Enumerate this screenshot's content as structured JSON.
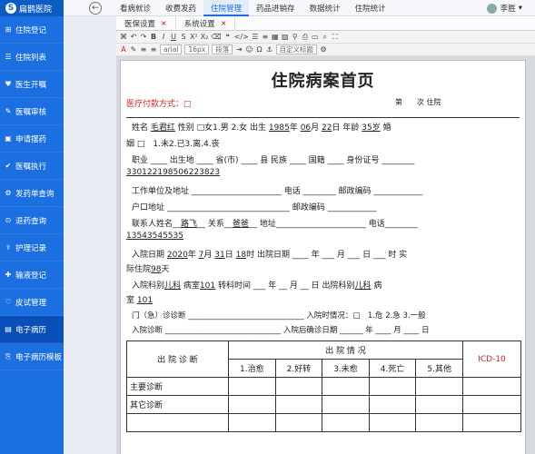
{
  "app": {
    "name": "扁鹊医院"
  },
  "sidebar": {
    "items": [
      {
        "label": "住院登记",
        "icon": "⊞"
      },
      {
        "label": "住院列表",
        "icon": "☰"
      },
      {
        "label": "医生开嘱",
        "icon": "♥"
      },
      {
        "label": "医嘱审核",
        "icon": "✎"
      },
      {
        "label": "申请摆药",
        "icon": "▣"
      },
      {
        "label": "医嘱执行",
        "icon": "✔"
      },
      {
        "label": "发药单查询",
        "icon": "⚙"
      },
      {
        "label": "退药查询",
        "icon": "⊙"
      },
      {
        "label": "护理记录",
        "icon": "⚕"
      },
      {
        "label": "输液登记",
        "icon": "✚"
      },
      {
        "label": "皮试管理",
        "icon": "♡"
      },
      {
        "label": "电子病历",
        "icon": "▤"
      },
      {
        "label": "电子病历模板",
        "icon": "⎘"
      }
    ],
    "active_index": 11
  },
  "top_tabs": [
    "看病就诊",
    "收费发药",
    "住院管理",
    "药品进销存",
    "数据统计",
    "住院统计"
  ],
  "top_active": 2,
  "user": {
    "name": "李胜"
  },
  "sub_tabs": [
    {
      "label": "医保设置"
    },
    {
      "label": "系统设置"
    }
  ],
  "toolbar": {
    "font": "arial",
    "size": "16px",
    "para": "段落",
    "custom": "自定义标题"
  },
  "doc": {
    "title": "住院病案首页",
    "pay_label": "医疗付款方式：□",
    "admit_no": "第　　次 住院",
    "name_label": "姓名",
    "name": "毛君红",
    "sex_label": "性别 □女1.男 2.女 出生",
    "birth_y": "1985",
    "birth_m": "06",
    "birth_d": "22",
    "age_label": "年龄",
    "age": "35岁",
    "marry_label": "婚",
    "marry_line": "姻 □　1.未2.已3.离.4.丧",
    "job_line": "职业 ____ 出生地 ____ 省(市) ____ 县 民族 ____ 国籍 ____ 身份证号 ________",
    "id": "330122198506223823",
    "work_line": "工作单位及地址 ______________________ 电话 ________ 邮政编码 ____________",
    "home_line": "户口地址 ______________________________ 邮政编码 ____________",
    "contact_name": "路飞",
    "contact_rel": "爸爸",
    "contact_label": "联系人姓名",
    "rel_label": "关系",
    "addr_label": "地址",
    "tel_label": "电话",
    "contact_tel": "13543545535",
    "in_y": "2020",
    "in_m": "7",
    "in_d": "31",
    "in_h": "18",
    "in_label": "入院日期",
    "out_line": "出院日期 ____ 年 ___ 月 ___ 日 ___ 时 实",
    "days_label": "际住院",
    "days": "98",
    "days_unit": "天",
    "dept_in": "儿科",
    "room_in": "101",
    "dept_label": "入院科别",
    "room_label": "病室",
    "transfer_line": "转科时间 ___ 年 __ 月 __ 日 出院科别",
    "dept_out": "儿科",
    "room_out_label": "病",
    "room_out": "101",
    "outpatient_line": "门（急）诊诊断 ______________________________ 入院时情况：□　1.危 2.急 3.一般",
    "admit_diag_line": "入院诊断 ______________________________ 入院后确诊日期 ______ 年 ____ 月 ____ 日",
    "table": {
      "h1": "出 院 诊 断",
      "h2": "出 院 情 况",
      "h3": "ICD-10",
      "c1": "1.治愈",
      "c2": "2.好转",
      "c3": "3.未愈",
      "c4": "4.死亡",
      "c5": "5.其他",
      "row1": "主要诊断",
      "row2": "其它诊断"
    }
  }
}
